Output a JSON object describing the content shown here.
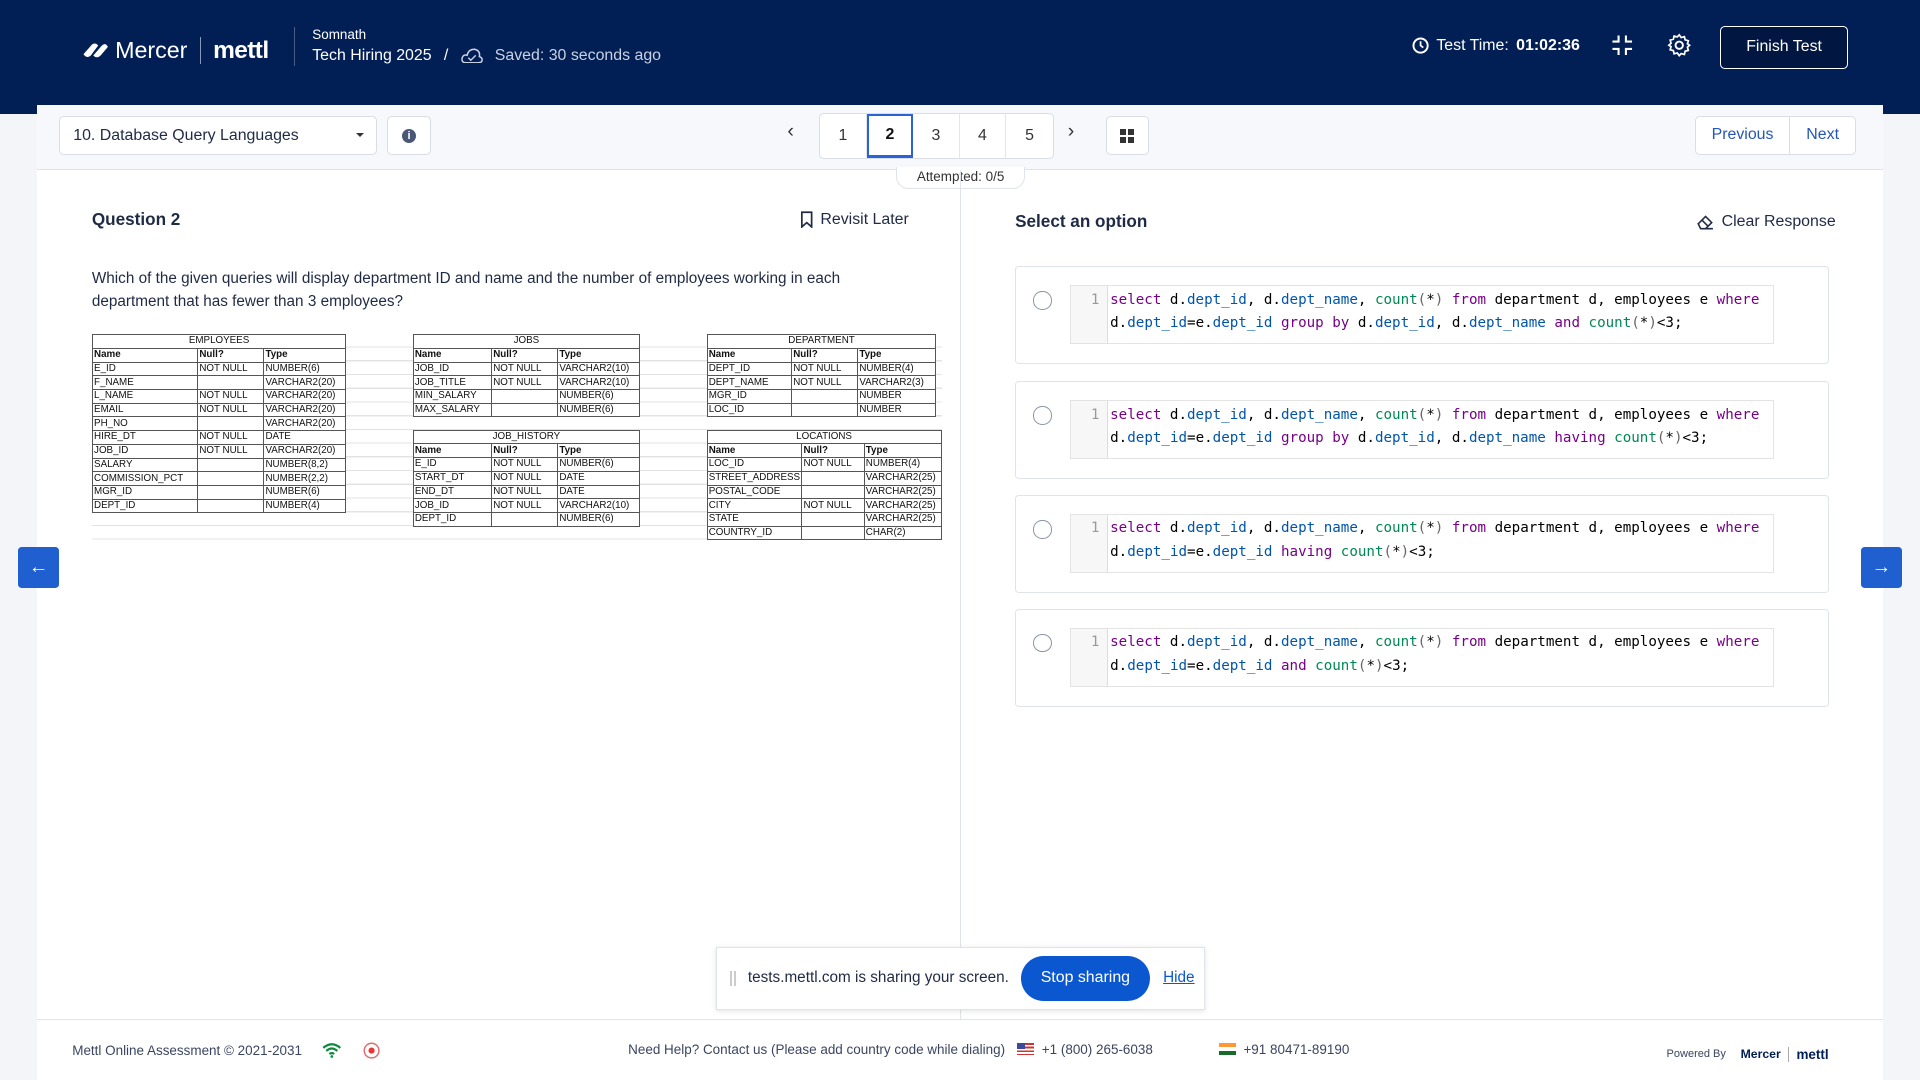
{
  "header": {
    "brand": "Mercer",
    "product": "mettl",
    "user": "Somnath",
    "test_name": "Tech Hiring 2025",
    "separator": "/",
    "saved": "Saved: 30 seconds ago",
    "timer_label": "Test Time:",
    "timer_value": "01:02:36",
    "finish": "Finish Test"
  },
  "toolbar": {
    "section": "10. Database Query Languages",
    "pages": [
      "1",
      "2",
      "3",
      "4",
      "5"
    ],
    "current_page": "2",
    "attempted": "Attempted: 0/5",
    "previous": "Previous",
    "next": "Next"
  },
  "question": {
    "title": "Question 2",
    "revisit": "Revisit Later",
    "text": "Which of the given queries will display department ID and name and the number of employees working in each department that has fewer than 3 employees?",
    "tables": [
      {
        "name": "EMPLOYEES",
        "columns": [
          "Name",
          "Null?",
          "Type"
        ],
        "rows": [
          [
            "E_ID",
            "NOT NULL",
            "NUMBER(6)"
          ],
          [
            "F_NAME",
            "",
            "VARCHAR2(20)"
          ],
          [
            "L_NAME",
            "NOT NULL",
            "VARCHAR2(20)"
          ],
          [
            "EMAIL",
            "NOT NULL",
            "VARCHAR2(20)"
          ],
          [
            "PH_NO",
            "",
            "VARCHAR2(20)"
          ],
          [
            "HIRE_DT",
            "NOT NULL",
            "DATE"
          ],
          [
            "JOB_ID",
            "NOT NULL",
            "VARCHAR2(20)"
          ],
          [
            "SALARY",
            "",
            "NUMBER(8,2)"
          ],
          [
            "COMMISSION_PCT",
            "",
            "NUMBER(2,2)"
          ],
          [
            "MGR_ID",
            "",
            "NUMBER(6)"
          ],
          [
            "DEPT_ID",
            "",
            "NUMBER(4)"
          ]
        ]
      },
      {
        "name": "JOBS",
        "columns": [
          "Name",
          "Null?",
          "Type"
        ],
        "rows": [
          [
            "JOB_ID",
            "NOT NULL",
            "VARCHAR2(10)"
          ],
          [
            "JOB_TITLE",
            "NOT NULL",
            "VARCHAR2(10)"
          ],
          [
            "MIN_SALARY",
            "",
            "NUMBER(6)"
          ],
          [
            "MAX_SALARY",
            "",
            "NUMBER(6)"
          ]
        ]
      },
      {
        "name": "JOB_HISTORY",
        "columns": [
          "Name",
          "Null?",
          "Type"
        ],
        "rows": [
          [
            "E_ID",
            "NOT NULL",
            "NUMBER(6)"
          ],
          [
            "START_DT",
            "NOT NULL",
            "DATE"
          ],
          [
            "END_DT",
            "NOT NULL",
            "DATE"
          ],
          [
            "JOB_ID",
            "NOT NULL",
            "VARCHAR2(10)"
          ],
          [
            "DEPT_ID",
            "",
            "NUMBER(6)"
          ]
        ]
      },
      {
        "name": "DEPARTMENT",
        "columns": [
          "Name",
          "Null?",
          "Type"
        ],
        "rows": [
          [
            "DEPT_ID",
            "NOT NULL",
            "NUMBER(4)"
          ],
          [
            "DEPT_NAME",
            "NOT NULL",
            "VARCHAR2(3)"
          ],
          [
            "MGR_ID",
            "",
            "NUMBER"
          ],
          [
            "LOC_ID",
            "",
            "NUMBER"
          ]
        ]
      },
      {
        "name": "LOCATIONS",
        "columns": [
          "Name",
          "Null?",
          "Type"
        ],
        "rows": [
          [
            "LOC_ID",
            "NOT NULL",
            "NUMBER(4)"
          ],
          [
            "STREET_ADDRESS",
            "",
            "VARCHAR2(25)"
          ],
          [
            "POSTAL_CODE",
            "",
            "VARCHAR2(25)"
          ],
          [
            "CITY",
            "NOT NULL",
            "VARCHAR2(25)"
          ],
          [
            "STATE",
            "",
            "VARCHAR2(25)"
          ],
          [
            "COUNTRY_ID",
            "",
            "CHAR(2)"
          ]
        ]
      }
    ]
  },
  "options": {
    "title": "Select an option",
    "clear": "Clear Response",
    "line_number": "1",
    "items": [
      {
        "tokens": [
          [
            "select",
            "kw"
          ],
          " d.",
          [
            "dept_id",
            "prop"
          ],
          ", d.",
          [
            "dept_name",
            "prop"
          ],
          ", ",
          [
            "count",
            "fn"
          ],
          [
            "(",
            "pun"
          ],
          "*",
          [
            ")",
            "pun"
          ],
          " ",
          [
            "from",
            "kw"
          ],
          " department d, employees e ",
          [
            "where",
            "kw"
          ],
          " d.",
          [
            "dept_id",
            "prop"
          ],
          "=e.",
          [
            "dept_id",
            "prop"
          ],
          " ",
          [
            "group by",
            "kw"
          ],
          " d.",
          [
            "dept_id",
            "prop"
          ],
          ", d.",
          [
            "dept_name",
            "prop"
          ],
          " ",
          [
            "and",
            "kw"
          ],
          " ",
          [
            "count",
            "fn"
          ],
          [
            "(",
            "pun"
          ],
          "*",
          [
            ")",
            "pun"
          ],
          "<3;"
        ]
      },
      {
        "tokens": [
          [
            "select",
            "kw"
          ],
          " d.",
          [
            "dept_id",
            "prop"
          ],
          ", d.",
          [
            "dept_name",
            "prop"
          ],
          ", ",
          [
            "count",
            "fn"
          ],
          [
            "(",
            "pun"
          ],
          "*",
          [
            ")",
            "pun"
          ],
          " ",
          [
            "from",
            "kw"
          ],
          " department d, employees e ",
          [
            "where",
            "kw"
          ],
          " d.",
          [
            "dept_id",
            "prop"
          ],
          "=e.",
          [
            "dept_id",
            "prop"
          ],
          " ",
          [
            "group by",
            "kw"
          ],
          " d.",
          [
            "dept_id",
            "prop"
          ],
          ", d.",
          [
            "dept_name",
            "prop"
          ],
          " ",
          [
            "having",
            "kw"
          ],
          " ",
          [
            "count",
            "fn"
          ],
          [
            "(",
            "pun"
          ],
          "*",
          [
            ")",
            "pun"
          ],
          "<3;"
        ]
      },
      {
        "tokens": [
          [
            "select",
            "kw"
          ],
          " d.",
          [
            "dept_id",
            "prop"
          ],
          ", d.",
          [
            "dept_name",
            "prop"
          ],
          ", ",
          [
            "count",
            "fn"
          ],
          [
            "(",
            "pun"
          ],
          "*",
          [
            ")",
            "pun"
          ],
          " ",
          [
            "from",
            "kw"
          ],
          " department d, employees e ",
          [
            "where",
            "kw"
          ],
          " d.",
          [
            "dept_id",
            "prop"
          ],
          "=e.",
          [
            "dept_id",
            "prop"
          ],
          " ",
          [
            "having",
            "kw"
          ],
          " ",
          [
            "count",
            "fn"
          ],
          [
            "(",
            "pun"
          ],
          "*",
          [
            ")",
            "pun"
          ],
          "<3;"
        ]
      },
      {
        "tokens": [
          [
            "select",
            "kw"
          ],
          " d.",
          [
            "dept_id",
            "prop"
          ],
          ", d.",
          [
            "dept_name",
            "prop"
          ],
          ", ",
          [
            "count",
            "fn"
          ],
          [
            "(",
            "pun"
          ],
          "*",
          [
            ")",
            "pun"
          ],
          " ",
          [
            "from",
            "kw"
          ],
          " department d, employees e ",
          [
            "where",
            "kw"
          ],
          " d.",
          [
            "dept_id",
            "prop"
          ],
          "=e.",
          [
            "dept_id",
            "prop"
          ],
          " ",
          [
            "and",
            "kw"
          ],
          " ",
          [
            "count",
            "fn"
          ],
          [
            "(",
            "pun"
          ],
          "*",
          [
            ")",
            "pun"
          ],
          "<3;"
        ]
      }
    ]
  },
  "share_bar": {
    "message": "tests.mettl.com is sharing your screen.",
    "stop": "Stop sharing",
    "hide": "Hide"
  },
  "footer": {
    "copyright": "Mettl Online Assessment © 2021-2031",
    "help": "Need Help? Contact us (Please add country code while dialing)",
    "us_phone": "+1 (800) 265-6038",
    "in_phone": "+91 80471-89190",
    "powered_by": "Powered By",
    "brand": "Mercer",
    "product": "mettl"
  },
  "colors": {
    "header_bg": "#021f55",
    "accent": "#1f5fcf",
    "keyword": "#770088",
    "property": "#0055aa",
    "function": "#008855"
  },
  "icons": [
    "cloud-icon",
    "clock-icon",
    "exit-fullscreen-icon",
    "gear-icon",
    "info-icon",
    "grid-icon",
    "bookmark-icon",
    "eraser-icon",
    "arrow-left-icon",
    "arrow-right-icon",
    "wifi-icon",
    "record-icon"
  ]
}
